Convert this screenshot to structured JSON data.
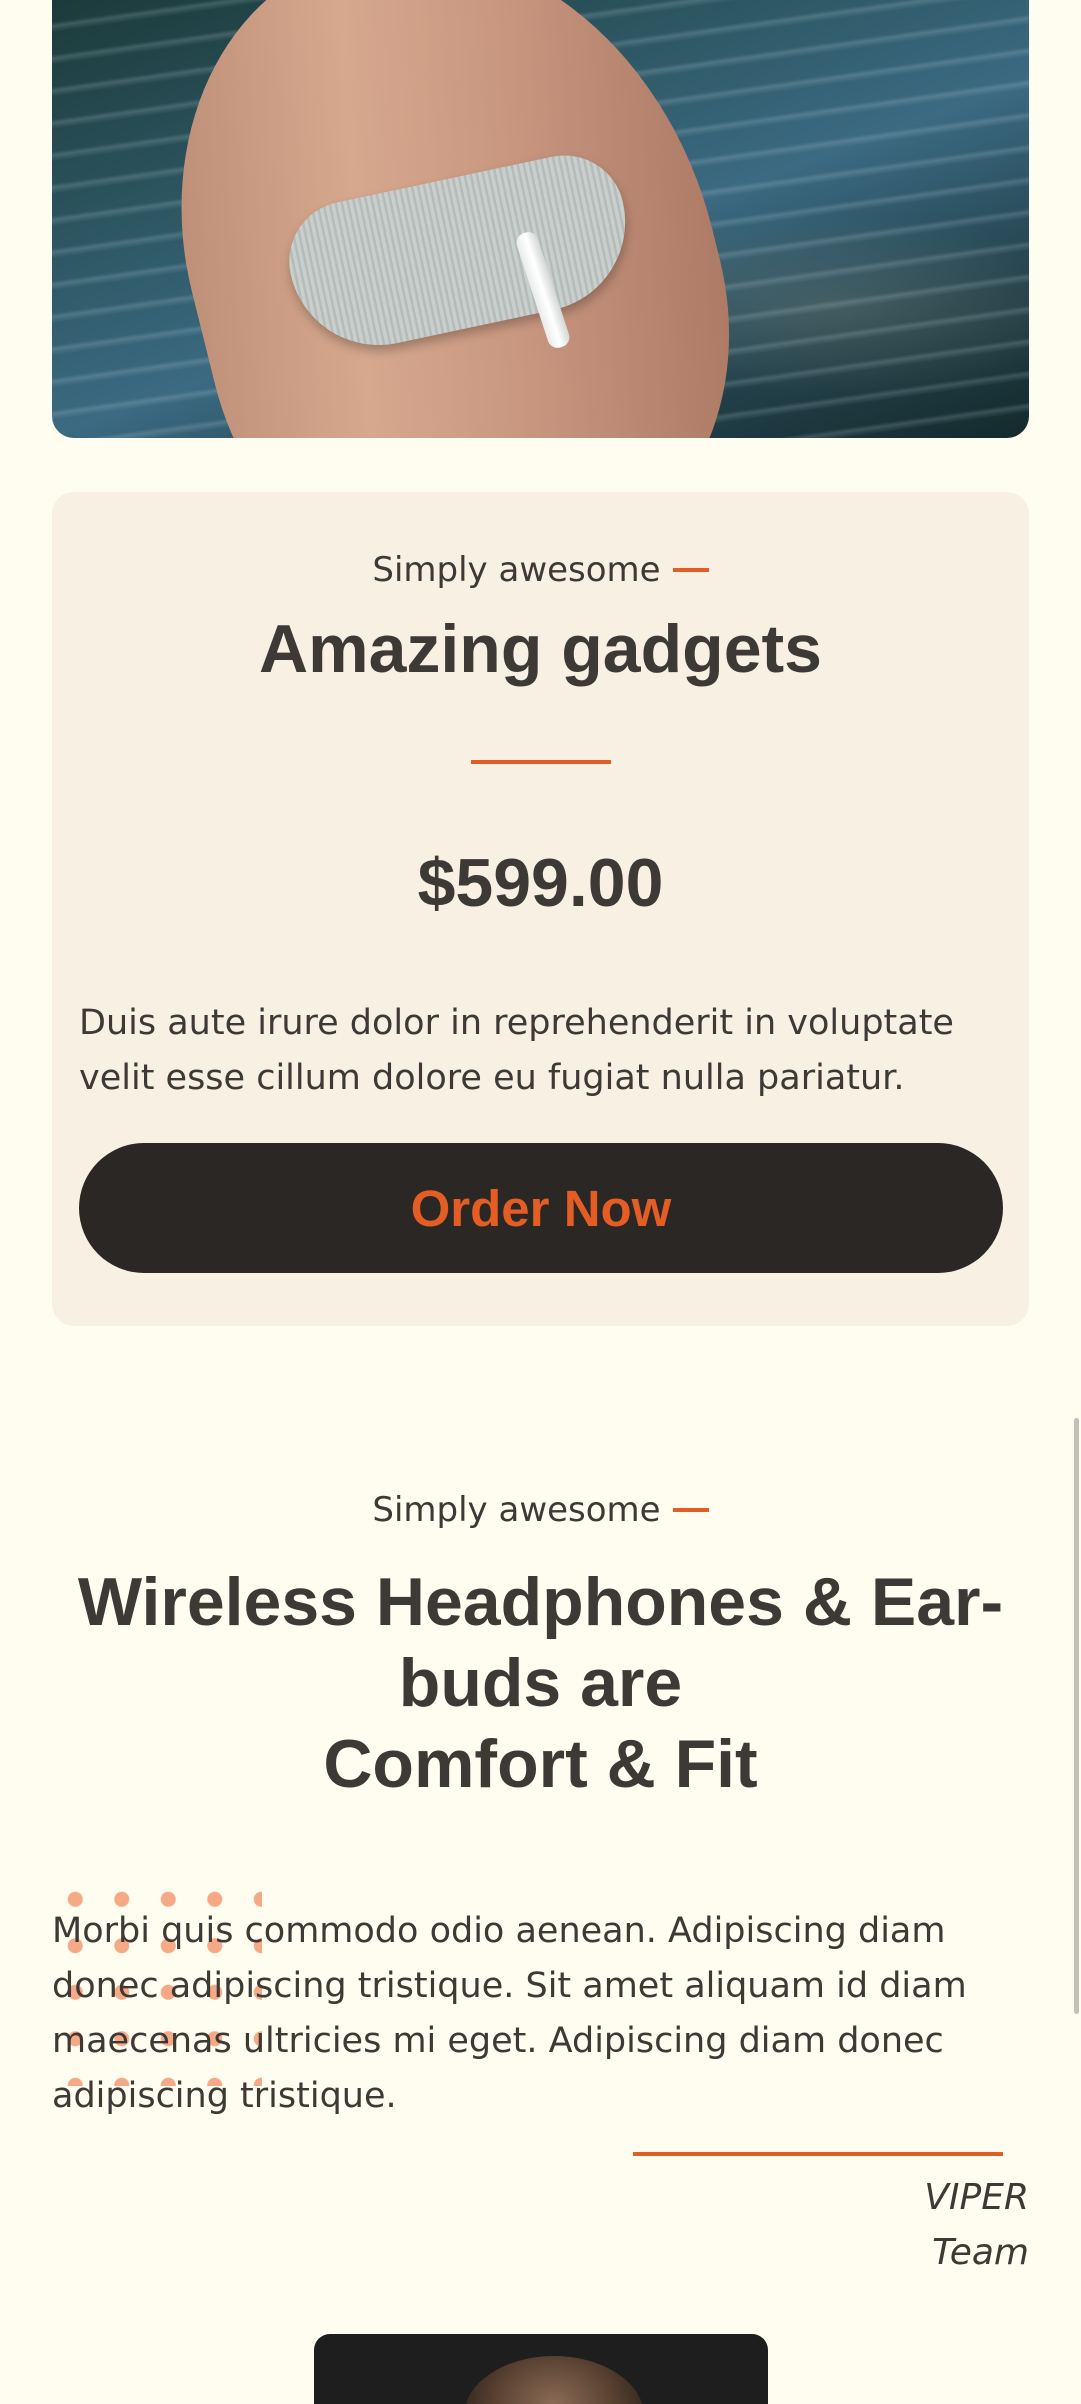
{
  "hero": {
    "image_alt": "wrist with fabric watch band over water",
    "icon": "smartwatch-photo"
  },
  "product_card": {
    "eyebrow": "Simply awesome",
    "title": "Amazing gadgets",
    "price": "$599.00",
    "description": "Duis aute irure dolor in reprehenderit in voluptate velit esse cillum dolore eu fugiat nulla pariatur.",
    "cta_label": "Order Now"
  },
  "feature": {
    "eyebrow": "Simply awesome",
    "title_lines": [
      "Wireless Headphones & Ear-",
      "buds are",
      "Comfort & Fit"
    ],
    "body": "Morbi quis commodo odio aenean. Adipiscing diam donec adipiscing tristique. Sit amet aliquam id diam maecenas ultricies mi eget. Adipiscing diam donec adipiscing tristique.",
    "signature_lines": [
      "VIPER",
      "Team"
    ]
  },
  "colors": {
    "page_bg": "#fffcf0",
    "card_bg": "#f8f0e3",
    "accent": "#e35d25",
    "text": "#3d3935",
    "button_bg": "#2a2725"
  }
}
